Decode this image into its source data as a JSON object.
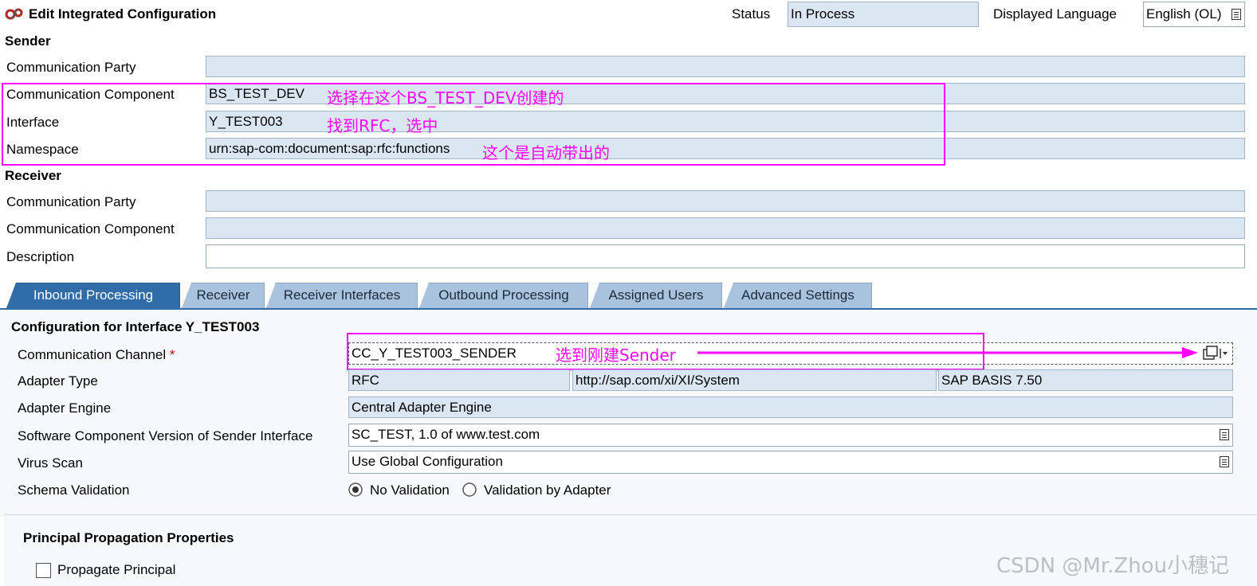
{
  "header": {
    "title": "Edit Integrated Configuration",
    "status_label": "Status",
    "status_value": "In Process",
    "language_label": "Displayed Language",
    "language_value": "English (OL)"
  },
  "sender": {
    "heading": "Sender",
    "party_label": "Communication Party",
    "party_value": "",
    "component_label": "Communication Component",
    "component_value": "BS_TEST_DEV",
    "interface_label": "Interface",
    "interface_value": "Y_TEST003",
    "namespace_label": "Namespace",
    "namespace_value": "urn:sap-com:document:sap:rfc:functions"
  },
  "receiver": {
    "heading": "Receiver",
    "party_label": "Communication Party",
    "party_value": "",
    "component_label": "Communication Component",
    "component_value": "",
    "description_label": "Description",
    "description_value": ""
  },
  "tabs": [
    {
      "label": "Inbound Processing"
    },
    {
      "label": "Receiver"
    },
    {
      "label": "Receiver Interfaces"
    },
    {
      "label": "Outbound Processing"
    },
    {
      "label": "Assigned Users"
    },
    {
      "label": "Advanced Settings"
    }
  ],
  "inbound": {
    "heading": "Configuration for Interface Y_TEST003",
    "channel_label": "Communication Channel",
    "required_mark": "*",
    "channel_value": "CC_Y_TEST003_SENDER",
    "adapter_type_label": "Adapter Type",
    "adapter_type_value": "RFC",
    "adapter_namespace_value": "http://sap.com/xi/XI/System",
    "adapter_swcv_value": "SAP BASIS 7.50",
    "adapter_engine_label": "Adapter Engine",
    "adapter_engine_value": "Central Adapter Engine",
    "swcv_label": "Software Component Version of Sender Interface",
    "swcv_value": "SC_TEST, 1.0 of www.test.com",
    "virus_scan_label": "Virus Scan",
    "virus_scan_value": "Use Global Configuration",
    "schema_label": "Schema Validation",
    "schema_option_1": "No Validation",
    "schema_option_2": "Validation by Adapter"
  },
  "principal": {
    "heading": "Principal Propagation Properties",
    "propagate_label": "Propagate Principal"
  },
  "annotations": {
    "component_note": "选择在这个BS_TEST_DEV创建的",
    "interface_note": "找到RFC，选中",
    "namespace_note": "这个是自动带出的",
    "channel_note": "选到刚建Sender",
    "color": "#ff00ff"
  },
  "watermark": "CSDN @Mr.Zhou小穗记"
}
